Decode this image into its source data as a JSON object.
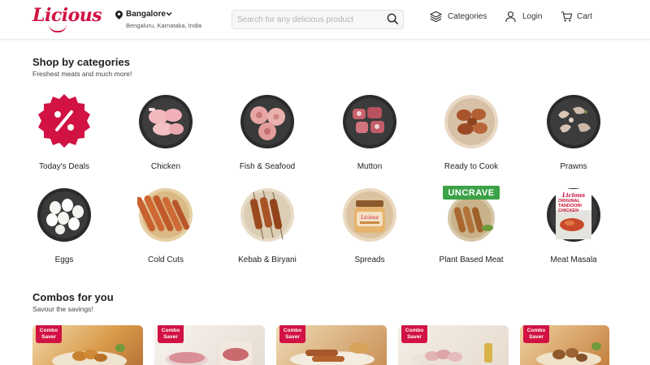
{
  "brand": {
    "name": "Licious",
    "color": "#d11243"
  },
  "location": {
    "city": "Bangalore",
    "detail": "Bengaluru, Karnataka, India"
  },
  "search": {
    "placeholder": "Search for any delicious product"
  },
  "nav": {
    "categories": "Categories",
    "login": "Login",
    "cart": "Cart"
  },
  "categories_section": {
    "title": "Shop by categories",
    "subtitle": "Freshest meats and much more!",
    "items": [
      {
        "label": "Today's Deals",
        "icon": "percent-deal-badge"
      },
      {
        "label": "Chicken",
        "icon": "chicken-plate"
      },
      {
        "label": "Fish & Seafood",
        "icon": "fish-plate"
      },
      {
        "label": "Mutton",
        "icon": "mutton-plate"
      },
      {
        "label": "Ready to Cook",
        "icon": "ready-to-cook-plate"
      },
      {
        "label": "Prawns",
        "icon": "prawns-plate"
      },
      {
        "label": "Eggs",
        "icon": "eggs-plate"
      },
      {
        "label": "Cold Cuts",
        "icon": "sausages-plate"
      },
      {
        "label": "Kebab & Biryani",
        "icon": "kebab-plate"
      },
      {
        "label": "Spreads",
        "icon": "spread-jar"
      },
      {
        "label": "Plant Based Meat",
        "icon": "plant-based-plate",
        "badge": "UNCRAVE"
      },
      {
        "label": "Meat Masala",
        "icon": "masala-pack",
        "pack_brand": "Licious",
        "pack_text": "ORIGINAL TANDOORI CHICKEN"
      }
    ]
  },
  "combos_section": {
    "title": "Combos for you",
    "subtitle": "Savour the savings!",
    "badge_line1": "Combo",
    "badge_line2": "Saver"
  }
}
